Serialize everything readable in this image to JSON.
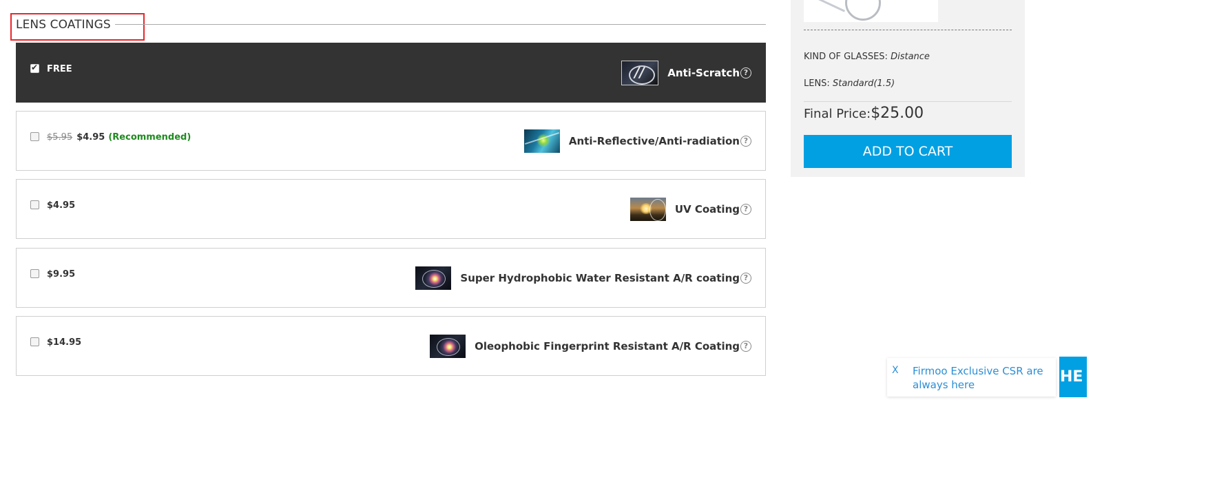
{
  "section": {
    "title": "LENS COATINGS"
  },
  "coatings": [
    {
      "price": "FREE",
      "name": "Anti-Scratch",
      "selected": true,
      "thumb_icon": "anti-scratch-thumbnail"
    },
    {
      "old_price": "$5.95",
      "price": "$4.95",
      "badge": "(Recommended)",
      "name": "Anti-Reflective/Anti-radiation",
      "selected": false,
      "thumb_icon": "anti-reflective-thumbnail"
    },
    {
      "price": "$4.95",
      "name": "UV Coating",
      "selected": false,
      "thumb_icon": "uv-coating-thumbnail"
    },
    {
      "price": "$9.95",
      "name": "Super Hydrophobic Water Resistant A/R coating",
      "selected": false,
      "thumb_icon": "hydrophobic-thumbnail"
    },
    {
      "price": "$14.95",
      "name": "Oleophobic Fingerprint Resistant A/R Coating",
      "selected": false,
      "thumb_icon": "oleophobic-thumbnail"
    }
  ],
  "help_glyph": "?",
  "summary": {
    "kind_label": "KIND OF GLASSES:",
    "kind_value": "Distance",
    "lens_label": "LENS:",
    "lens_value": "Standard(1.5)",
    "final_label": "Final Price:",
    "final_value": "$25.00",
    "add_to_cart": "ADD TO CART"
  },
  "chat": {
    "close": "X",
    "message": "Firmoo Exclusive CSR are always here",
    "tab_label": "HE"
  },
  "colors": {
    "accent": "#00a0e3",
    "selected_row": "#333333",
    "recommended": "#1f8a1f",
    "highlight_box": "#e8262b"
  }
}
